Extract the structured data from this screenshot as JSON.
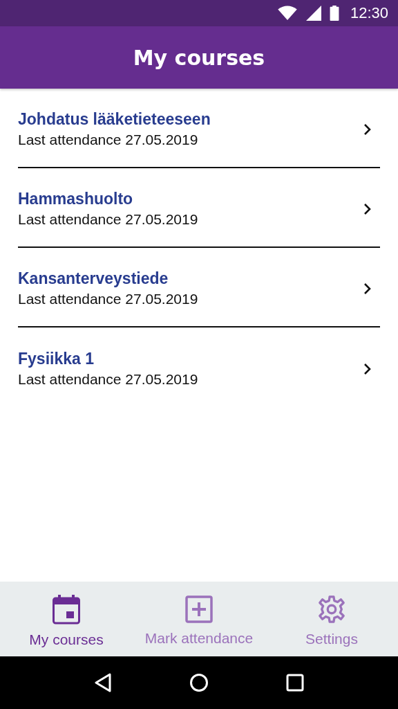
{
  "status_bar": {
    "time": "12:30"
  },
  "app_bar": {
    "title": "My courses"
  },
  "courses": [
    {
      "name": "Johdatus lääketieteeseen",
      "detail": "Last attendance 27.05.2019"
    },
    {
      "name": "Hammashuolto",
      "detail": "Last attendance 27.05.2019"
    },
    {
      "name": "Kansanterveystiede",
      "detail": "Last attendance 27.05.2019"
    },
    {
      "name": "Fysiikka 1",
      "detail": "Last attendance 27.05.2019"
    }
  ],
  "bottom_nav": [
    {
      "kind": "calendar",
      "label": "My courses",
      "selected": true
    },
    {
      "kind": "add",
      "label": "Mark attendance",
      "selected": false
    },
    {
      "kind": "settings",
      "label": "Settings",
      "selected": false
    }
  ]
}
